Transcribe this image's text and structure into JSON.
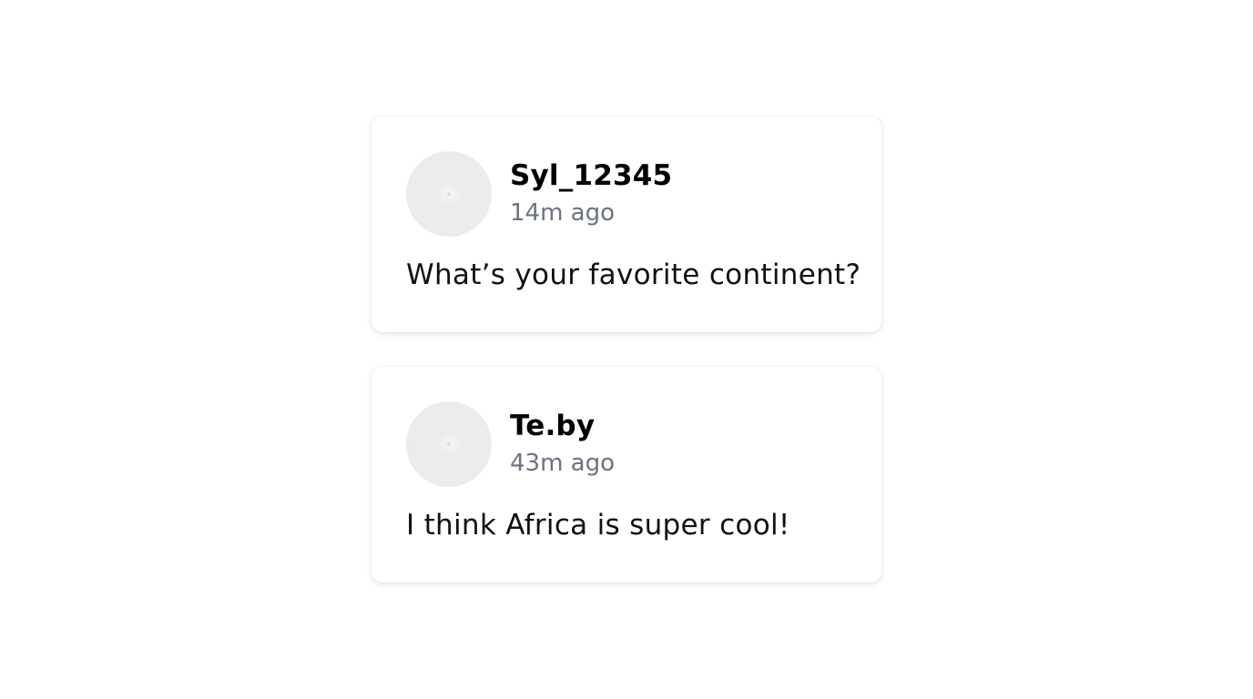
{
  "posts": [
    {
      "username": "Syl_12345",
      "time": "14m ago",
      "text": "What’s your favorite continent?",
      "avatar_icon": "default-avatar-icon"
    },
    {
      "username": "Te.by",
      "time": "43m ago",
      "text": "I think Africa is super cool!",
      "avatar_icon": "default-avatar-icon"
    }
  ],
  "colors": {
    "background": "#ffffff",
    "card": "#ffffff",
    "username": "#000000",
    "timestamp": "#6b7280",
    "avatar_placeholder": "#ebebeb"
  }
}
